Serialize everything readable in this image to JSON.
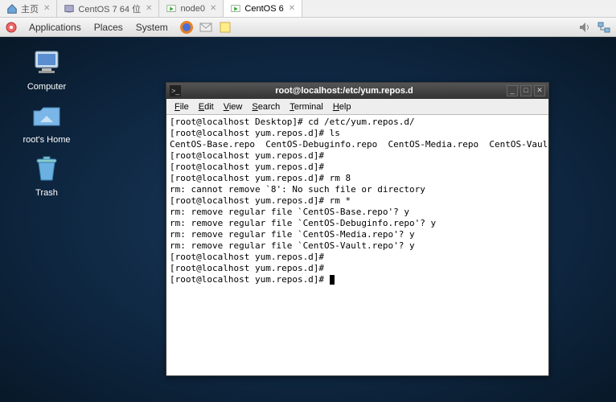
{
  "outerTabs": [
    {
      "label": "主页",
      "active": false
    },
    {
      "label": "CentOS 7 64 位",
      "active": false
    },
    {
      "label": "node0",
      "active": false
    },
    {
      "label": "CentOS 6",
      "active": true
    }
  ],
  "panel": {
    "menus": [
      "Applications",
      "Places",
      "System"
    ]
  },
  "desktop": {
    "computer": "Computer",
    "home": "root's Home",
    "trash": "Trash"
  },
  "terminal": {
    "title": "root@localhost:/etc/yum.repos.d",
    "menus": [
      {
        "u": "F",
        "rest": "ile"
      },
      {
        "u": "E",
        "rest": "dit"
      },
      {
        "u": "V",
        "rest": "iew"
      },
      {
        "u": "S",
        "rest": "earch"
      },
      {
        "u": "T",
        "rest": "erminal"
      },
      {
        "u": "H",
        "rest": "elp"
      }
    ],
    "lines": [
      "[root@localhost Desktop]# cd /etc/yum.repos.d/",
      "[root@localhost yum.repos.d]# ls",
      "CentOS-Base.repo  CentOS-Debuginfo.repo  CentOS-Media.repo  CentOS-Vault.repo",
      "[root@localhost yum.repos.d]#",
      "[root@localhost yum.repos.d]#",
      "[root@localhost yum.repos.d]# rm 8",
      "rm: cannot remove `8': No such file or directory",
      "[root@localhost yum.repos.d]# rm *",
      "rm: remove regular file `CentOS-Base.repo'? y",
      "rm: remove regular file `CentOS-Debuginfo.repo'? y",
      "rm: remove regular file `CentOS-Media.repo'? y",
      "rm: remove regular file `CentOS-Vault.repo'? y",
      "[root@localhost yum.repos.d]#",
      "[root@localhost yum.repos.d]#",
      "[root@localhost yum.repos.d]# "
    ]
  }
}
